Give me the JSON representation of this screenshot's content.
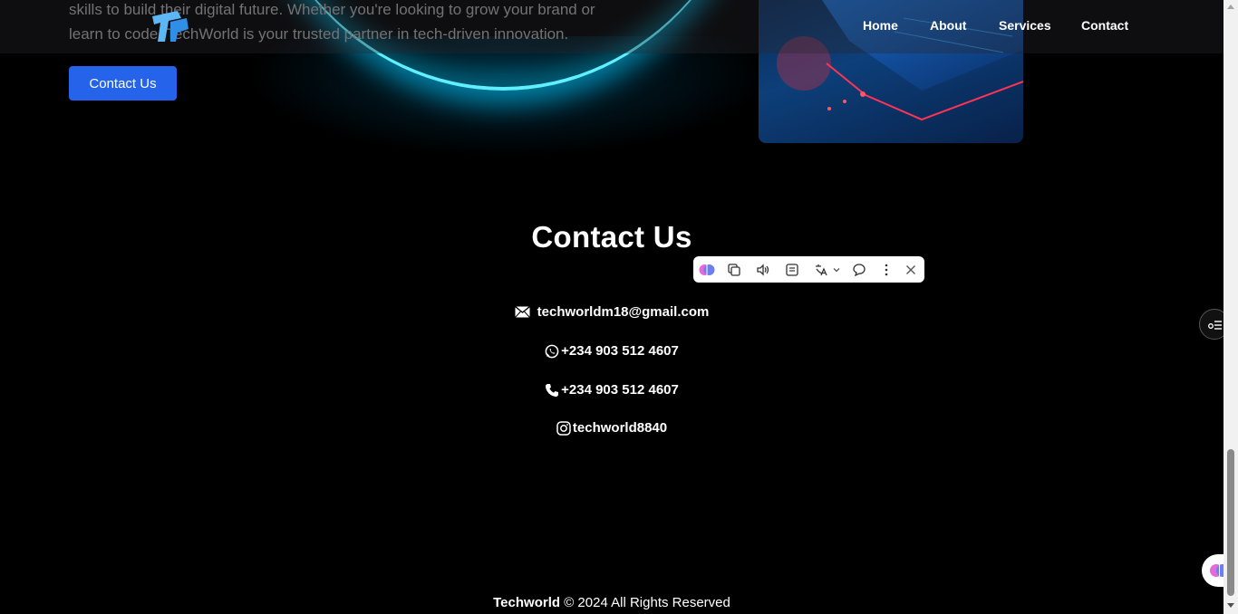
{
  "hero": {
    "line1": "skills to build their digital future. Whether you're looking to grow your brand or",
    "line2": "learn to code, TechWorld is your trusted partner in tech-driven innovation.",
    "cta_label": "Contact Us"
  },
  "nav": {
    "items": [
      {
        "label": "Home"
      },
      {
        "label": "About"
      },
      {
        "label": "Services"
      },
      {
        "label": "Contact"
      }
    ]
  },
  "contact": {
    "title": "Contact Us",
    "email": "techworldm18@gmail.com",
    "whatsapp": "+234 903 512 4607",
    "phone": "+234 903 512 4607",
    "instagram": "techworld8840"
  },
  "footer": {
    "brand": "Techworld",
    "text": " © 2024 All Rights Reserved"
  },
  "toolbar": {
    "icons": [
      "brain-icon",
      "copy-icon",
      "speaker-icon",
      "notes-icon",
      "translate-icon",
      "chevron-down-icon",
      "comment-icon",
      "more-icon",
      "close-icon"
    ]
  },
  "colors": {
    "accent_button": "#2563eb",
    "glow": "#5ff0ff",
    "background": "#000000"
  }
}
